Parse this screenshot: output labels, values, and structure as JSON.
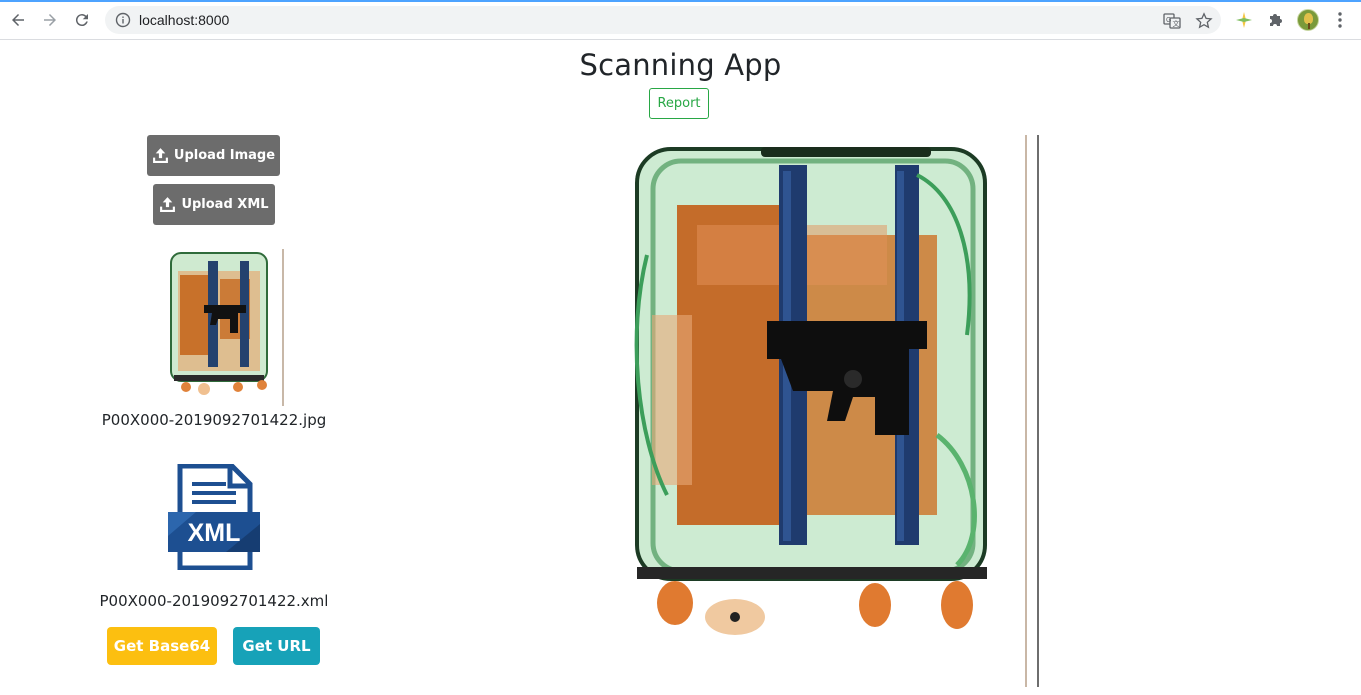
{
  "browser": {
    "url": "localhost:8000"
  },
  "page": {
    "title": "Scanning App",
    "report_label": "Report"
  },
  "sidebar": {
    "upload_image_label": "Upload Image",
    "upload_xml_label": "Upload XML",
    "image_filename": "P00X000-2019092701422.jpg",
    "xml_icon_text": "XML",
    "xml_filename": "P00X000-2019092701422.xml",
    "get_base64_label": "Get Base64",
    "get_url_label": "Get URL"
  },
  "colors": {
    "report_outline": "#28a745",
    "upload_button": "#6c6c6c",
    "base64_button": "#fcbf10",
    "url_button": "#17a2b8",
    "xml_icon_blue": "#1d4f91"
  },
  "icons": [
    "back-icon",
    "forward-icon",
    "reload-icon",
    "info-icon",
    "translate-icon",
    "star-icon",
    "extension-icon",
    "puzzle-icon",
    "avatar",
    "kebab-menu-icon",
    "upload-icon",
    "xml-file-icon"
  ]
}
